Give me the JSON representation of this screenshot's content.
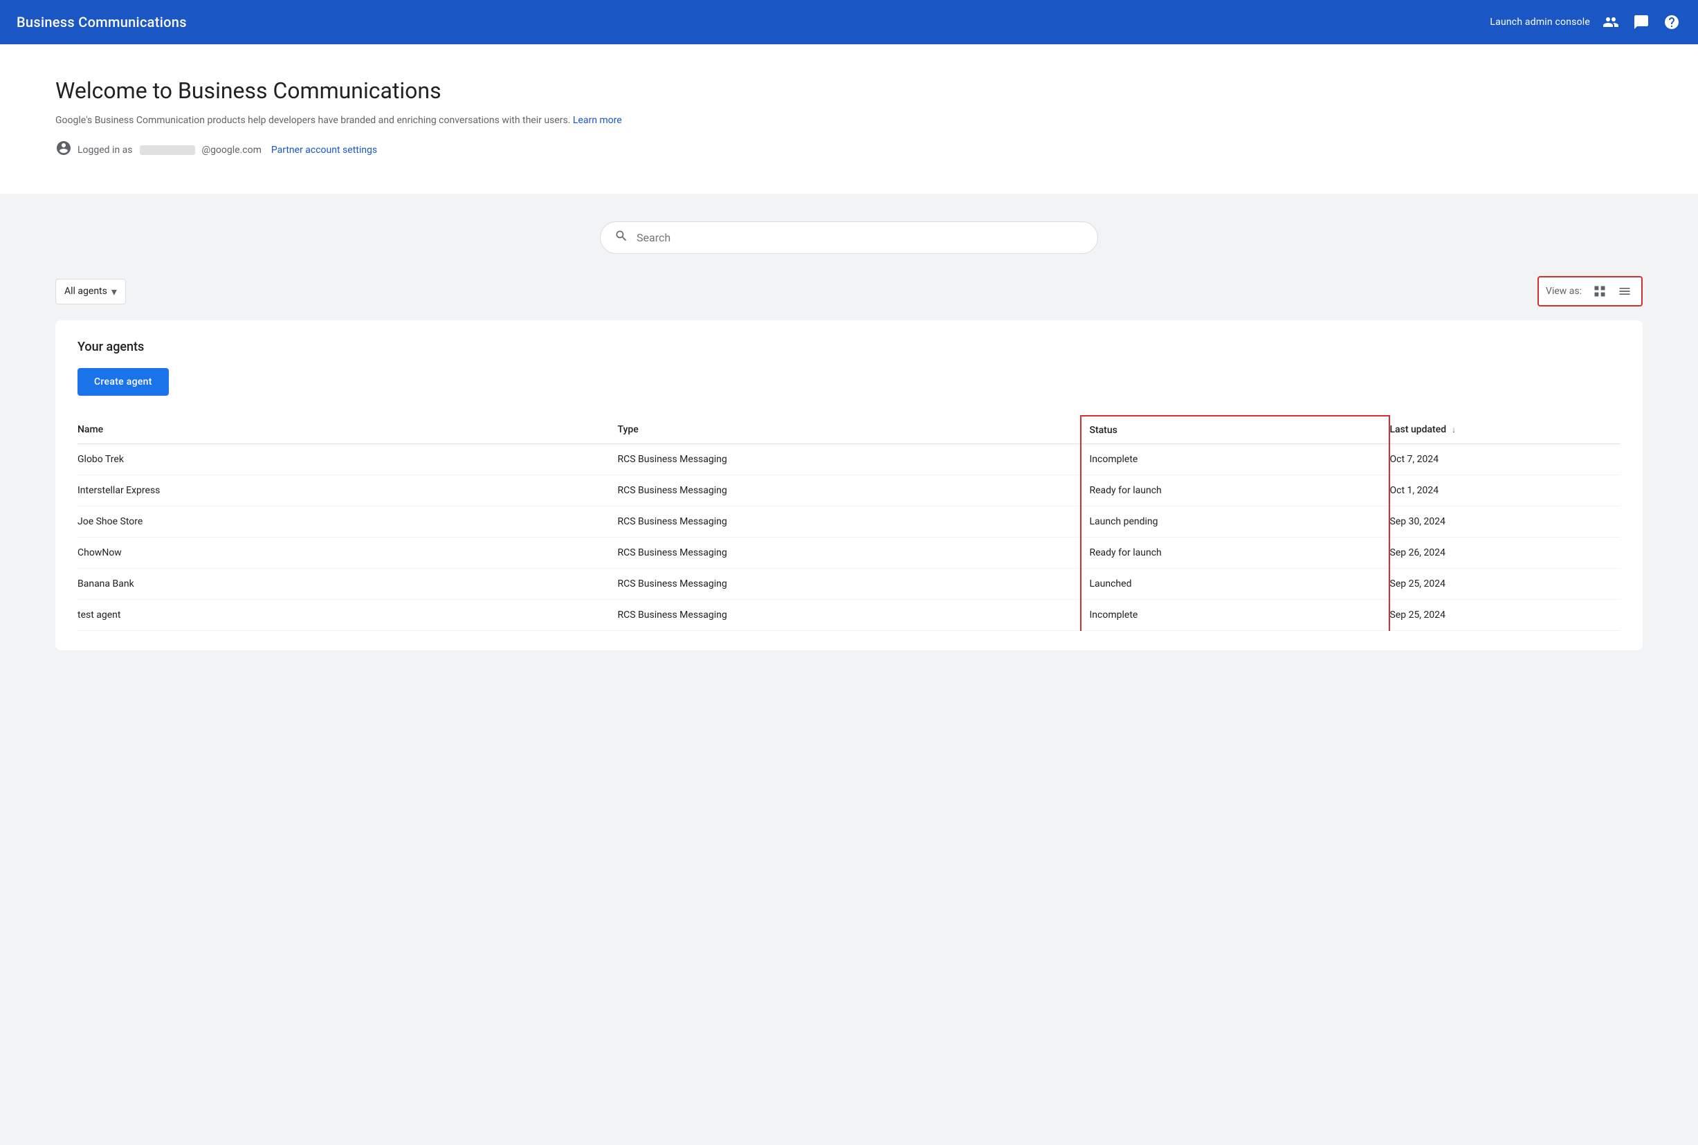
{
  "header": {
    "title": "Business Communications",
    "launch_btn": "Launch admin console",
    "icons": [
      "people-icon",
      "chat-icon",
      "help-icon"
    ]
  },
  "welcome": {
    "title": "Welcome to Business Communications",
    "description": "Google's Business Communication products help developers have branded and enriching conversations with their users.",
    "learn_more_label": "Learn more",
    "logged_in_prefix": "Logged in as",
    "email_domain": "@google.com",
    "partner_settings_label": "Partner account settings"
  },
  "search": {
    "placeholder": "Search"
  },
  "filter": {
    "all_agents_label": "All agents",
    "view_as_label": "View as:"
  },
  "agents": {
    "section_title": "Your agents",
    "create_btn_label": "Create agent",
    "table": {
      "columns": [
        {
          "key": "name",
          "label": "Name"
        },
        {
          "key": "type",
          "label": "Type"
        },
        {
          "key": "status",
          "label": "Status"
        },
        {
          "key": "last_updated",
          "label": "Last updated"
        }
      ],
      "rows": [
        {
          "name": "Globo Trek",
          "type": "RCS Business Messaging",
          "status": "Incomplete",
          "last_updated": "Oct 7, 2024"
        },
        {
          "name": "Interstellar Express",
          "type": "RCS Business Messaging",
          "status": "Ready for launch",
          "last_updated": "Oct 1, 2024"
        },
        {
          "name": "Joe Shoe Store",
          "type": "RCS Business Messaging",
          "status": "Launch pending",
          "last_updated": "Sep 30, 2024"
        },
        {
          "name": "ChowNow",
          "type": "RCS Business Messaging",
          "status": "Ready for launch",
          "last_updated": "Sep 26, 2024"
        },
        {
          "name": "Banana Bank",
          "type": "RCS Business Messaging",
          "status": "Launched",
          "last_updated": "Sep 25, 2024"
        },
        {
          "name": "test agent",
          "type": "RCS Business Messaging",
          "status": "Incomplete",
          "last_updated": "Sep 25, 2024"
        }
      ]
    }
  }
}
